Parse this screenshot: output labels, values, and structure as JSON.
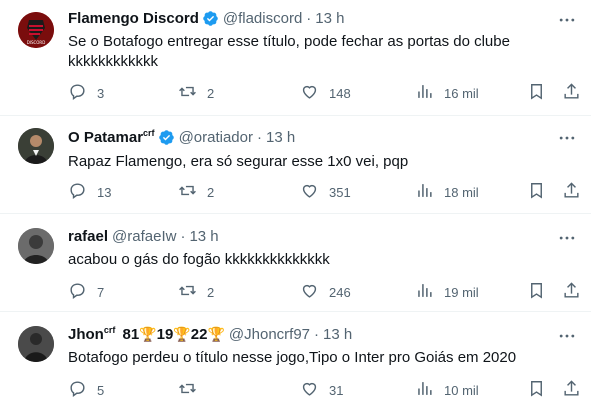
{
  "replies": [
    {
      "name": "Flamengo Discord",
      "name_sup": "",
      "handle": "@fladiscord",
      "time": "13 h",
      "text_lines": [
        "Se o Botafogo entregar esse título, pode fechar as portas do clube",
        "kkkkkkkkkkkk"
      ],
      "replies": "3",
      "retweets": "2",
      "likes": "148",
      "views": "16 mil",
      "verified": true
    },
    {
      "name": "O Patamar",
      "name_sup": "crf",
      "handle": "@oratiador",
      "time": "13 h",
      "text_lines": [
        "Rapaz Flamengo, era só segurar esse 1x0 vei, pqp"
      ],
      "replies": "13",
      "retweets": "2",
      "likes": "351",
      "views": "18 mil",
      "verified": true
    },
    {
      "name": "rafael",
      "name_sup": "",
      "handle": "@rafaeIw",
      "time": "13 h",
      "text_lines": [
        "acabou o gás do fogão kkkkkkkkkkkkkk"
      ],
      "replies": "7",
      "retweets": "2",
      "likes": "246",
      "views": "19 mil",
      "verified": false
    },
    {
      "name": "Jhon",
      "name_sup": "crf",
      "name_extra": [
        "81",
        "19",
        "22"
      ],
      "handle": "@Jhoncrf97",
      "time": "13 h",
      "text_lines": [
        "Botafogo perdeu o título nesse jogo,Tipo o Inter pro Goiás em 2020"
      ],
      "replies": "5",
      "retweets": "",
      "likes": "31",
      "views": "10 mil",
      "verified": false
    }
  ],
  "colors": {
    "verified": "#1d9bf0",
    "muted": "#536471",
    "text": "#0f1419",
    "divider": "#eff3f4"
  },
  "icons": [
    "reply-icon",
    "retweet-icon",
    "like-icon",
    "views-icon",
    "bookmark-icon",
    "share-icon",
    "more-icon",
    "verified-icon",
    "trophy-icon"
  ]
}
